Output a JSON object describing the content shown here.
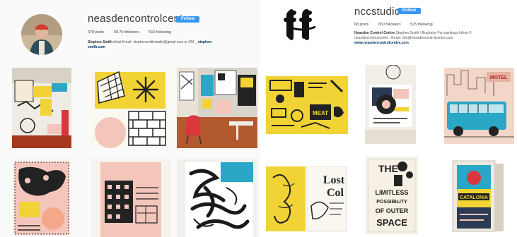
{
  "left_profile": {
    "username": "neasdencontrolcentre",
    "follow_label": "Follow",
    "stats": {
      "posts": "378 posts",
      "followers": "58.7k followers",
      "following": "516 following"
    },
    "bio_name": "Stephen Smith",
    "bio_text": "Artist Email: stephensmithstudio@gmail.com or DM _",
    "bio_link_a": "stephen-",
    "bio_link_b": "smith.com"
  },
  "right_profile": {
    "username": "nccstudio",
    "follow_label": "Follow",
    "stats": {
      "posts": "68 posts",
      "followers": "650 followers",
      "following": "525 following"
    },
    "bio_name": "Neasden Control Centre",
    "bio_line1": "Stephen Smith / Illustrator For paintings follow ©",
    "bio_line2": "neasdencontrolcentre . Email: info@neasdencontrolcentre.com",
    "bio_link": "www.neasdencontrolcentre.com",
    "avatar_text": "ff"
  },
  "posts": {
    "meat_label": "MEAT",
    "motel_label": "MOTEL",
    "lost_word1": "Lost",
    "lost_word2": "Col",
    "poster_the": "THE",
    "poster_line1": "LIMITLESS",
    "poster_line2": "POSSIBILITY",
    "poster_line3": "OF OUTER",
    "poster_line4": "SPACE",
    "book_title": "CATALONIA"
  },
  "colors": {
    "follow_blue": "#3897f0",
    "yellow": "#f2d335",
    "pink": "#f4c6bb",
    "teal": "#2aa6c6"
  }
}
